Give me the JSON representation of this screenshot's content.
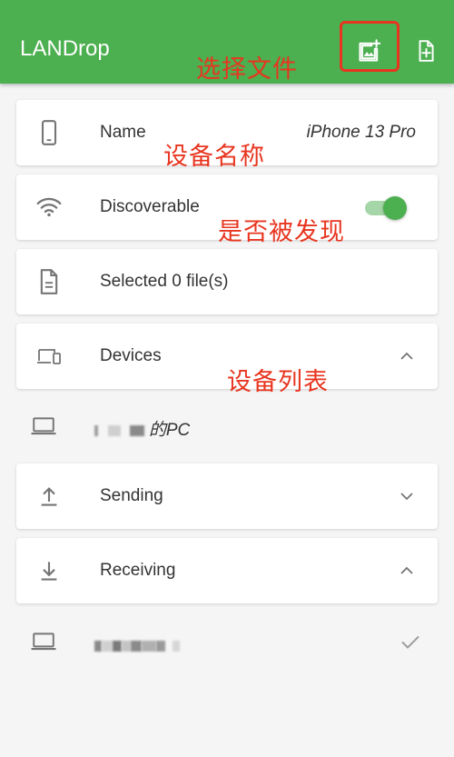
{
  "app": {
    "title": "LANDrop",
    "pick_media_icon": "add-photo-icon",
    "pick_file_icon": "note-add-icon"
  },
  "annotations": {
    "select_file": "选择文件",
    "device_name": "设备名称",
    "discoverable": "是否被发现",
    "device_list": "设备列表"
  },
  "settings": {
    "name_label": "Name",
    "name_value": "iPhone 13 Pro",
    "discoverable_label": "Discoverable",
    "discoverable_on": true,
    "selected_label": "Selected 0 file(s)"
  },
  "sections": {
    "devices_label": "Devices",
    "devices_expanded": true,
    "sending_label": "Sending",
    "sending_expanded": false,
    "receiving_label": "Receiving",
    "receiving_expanded": true
  },
  "devices": [
    {
      "name": "的PC",
      "icon": "laptop-icon"
    }
  ],
  "receiving_items": [
    {
      "icon": "laptop-icon",
      "status": "check-icon"
    }
  ],
  "colors": {
    "primary": "#4caf50",
    "annotation": "#e8351f",
    "icon_grey": "#757575"
  }
}
